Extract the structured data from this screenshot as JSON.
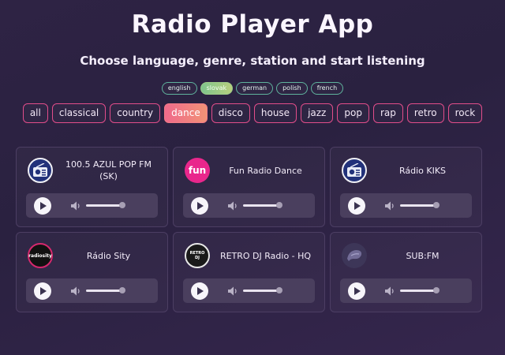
{
  "header": {
    "title": "Radio Player App",
    "subtitle": "Choose language, genre, station and start listening"
  },
  "languages": [
    {
      "label": "english",
      "active": false
    },
    {
      "label": "slovak",
      "active": true
    },
    {
      "label": "german",
      "active": false
    },
    {
      "label": "polish",
      "active": false
    },
    {
      "label": "french",
      "active": false
    }
  ],
  "genres": [
    {
      "label": "all",
      "active": false
    },
    {
      "label": "classical",
      "active": false
    },
    {
      "label": "country",
      "active": false
    },
    {
      "label": "dance",
      "active": true
    },
    {
      "label": "disco",
      "active": false
    },
    {
      "label": "house",
      "active": false
    },
    {
      "label": "jazz",
      "active": false
    },
    {
      "label": "pop",
      "active": false
    },
    {
      "label": "rap",
      "active": false
    },
    {
      "label": "retro",
      "active": false
    },
    {
      "label": "rock",
      "active": false
    }
  ],
  "stations": [
    {
      "name": "100.5 AZUL POP FM (SK)",
      "logo": "radio-icon",
      "volume": 1.0
    },
    {
      "name": "Fun Radio Dance",
      "logo": "fun-radio-logo",
      "logo_text": "fun",
      "volume": 1.0
    },
    {
      "name": "Rádio KIKS",
      "logo": "radio-icon",
      "volume": 1.0
    },
    {
      "name": "Rádio Sity",
      "logo": "radio-sity-logo",
      "logo_text": "radiosity",
      "volume": 1.0
    },
    {
      "name": "RETRO DJ Radio - HQ",
      "logo": "retro-dj-logo",
      "logo_text": "RETRO DJ",
      "volume": 1.0
    },
    {
      "name": "SUB:FM",
      "logo": "subfm-logo",
      "volume": 1.0
    }
  ],
  "colors": {
    "background": "#2b2142",
    "accent_pink": "#e24d8a",
    "accent_green": "#5fb39d",
    "player_bar": "#4a3f5e"
  }
}
